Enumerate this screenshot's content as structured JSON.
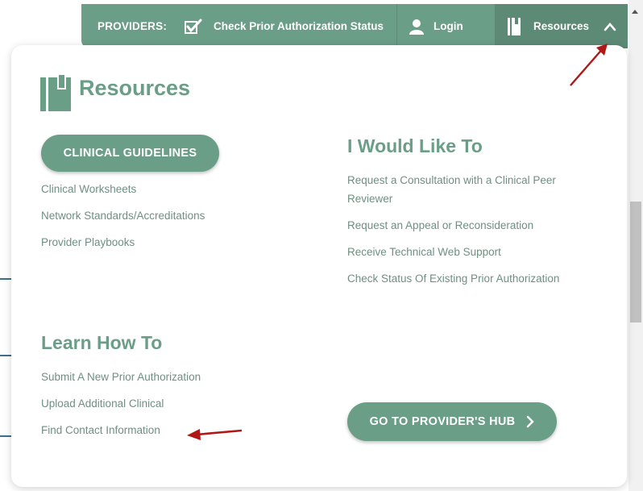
{
  "nav": {
    "providers_label": "PROVIDERS:",
    "check_status_label": "Check Prior Authorization Status",
    "login_label": "Login",
    "resources_label": "Resources"
  },
  "panel": {
    "title": "Resources",
    "clinical_guidelines_button": "CLINICAL GUIDELINES",
    "left_links": [
      "Clinical Worksheets",
      "Network Standards/Accreditations",
      "Provider Playbooks"
    ],
    "learn_heading": "Learn How To",
    "learn_links": [
      "Submit A New Prior Authorization",
      "Upload Additional Clinical",
      "Find Contact Information"
    ],
    "would_like_heading": "I Would Like To",
    "would_like_links": [
      "Request a Consultation with a Clinical Peer",
      "Reviewer",
      "Request an Appeal or Reconsideration",
      "Receive Technical Web Support",
      "Check Status Of Existing Prior Authorization"
    ],
    "hub_button": "GO TO PROVIDER'S HUB"
  },
  "colors": {
    "brand_green": "#6b9e87",
    "active_tab": "#5c8a75",
    "link_text": "#6f8f82",
    "annotation_arrow": "#b01818"
  },
  "icons": [
    "checkbox-icon",
    "user-icon",
    "book-icon",
    "chevron-up-icon",
    "chevron-right-icon",
    "arrow-annotation-icon"
  ]
}
